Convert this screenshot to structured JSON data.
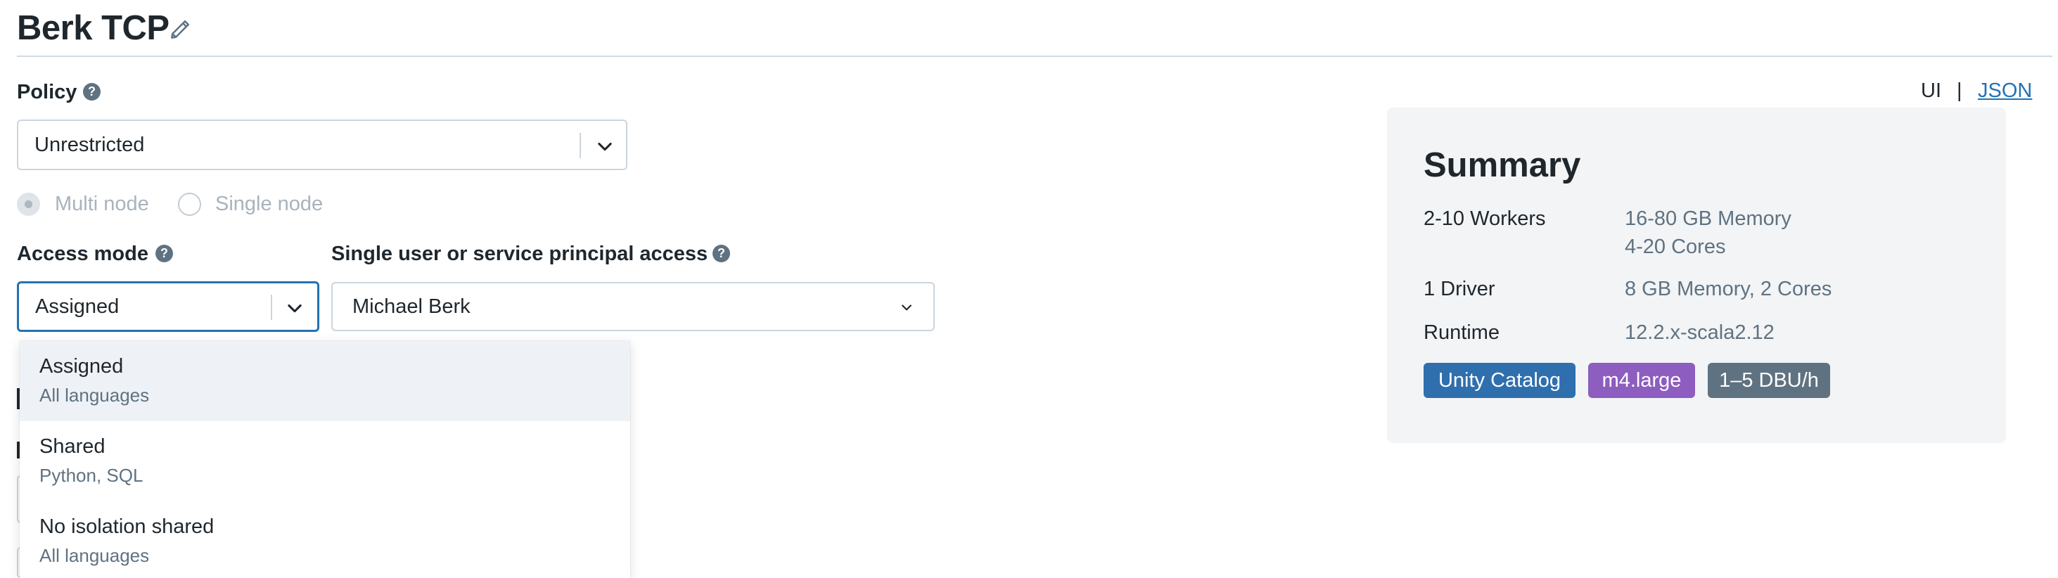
{
  "header": {
    "title": "Berk TCP"
  },
  "policy": {
    "label": "Policy",
    "help": "?",
    "value": "Unrestricted"
  },
  "node_type": {
    "options": [
      {
        "label": "Multi node",
        "selected": true
      },
      {
        "label": "Single node",
        "selected": false
      }
    ]
  },
  "access_mode": {
    "label": "Access mode",
    "help": "?",
    "value": "Assigned",
    "menu": [
      {
        "title": "Assigned",
        "subtitle": "All languages",
        "active": true
      },
      {
        "title": "Shared",
        "subtitle": "Python, SQL",
        "active": false
      },
      {
        "title": "No isolation shared",
        "subtitle": "All languages",
        "active": false
      }
    ]
  },
  "single_user": {
    "label": "Single user or service principal access",
    "help": "?",
    "value": "Michael Berk"
  },
  "view_toggle": {
    "ui": "UI",
    "separator": "|",
    "json": "JSON"
  },
  "summary": {
    "title": "Summary",
    "rows": [
      {
        "key": "2-10 Workers",
        "values": [
          "16-80 GB Memory",
          "4-20 Cores"
        ]
      },
      {
        "key": "1 Driver",
        "values": [
          "8 GB Memory, 2 Cores"
        ]
      },
      {
        "key": "Runtime",
        "values": [
          "12.2.x-scala2.12"
        ]
      }
    ],
    "badges": [
      {
        "label": "Unity Catalog",
        "color": "#2f6fae"
      },
      {
        "label": "m4.large",
        "color": "#8d5dbf"
      },
      {
        "label": "1–5 DBU/h",
        "color": "#5f7281"
      }
    ]
  }
}
